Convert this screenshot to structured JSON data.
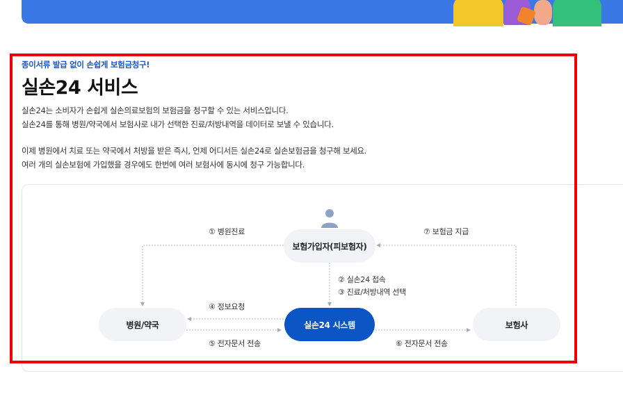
{
  "section": {
    "eyebrow": "종이서류 발급 없이 손쉽게 보험금청구!",
    "title": "실손24 서비스",
    "description": [
      "실손24는 소비자가 손쉽게 실손의료보험의 보험금을 청구할 수 있는 서비스입니다.",
      "실손24를 통해 병원/약국에서 보험사로 내가 선택한 진료/처방내역을 데이터로 보낼 수 있습니다.",
      "이제 병원에서 치료 또는 약국에서 처방을 받은 즉시, 언제 어디서든 실손24로 실손보험금을 청구해 보세요.",
      "여러 개의 실손보험에 가입했을 경우에도 한번에 여러 보험사에 동시에 청구 가능합니다."
    ]
  },
  "diagram": {
    "nodes": {
      "insured": "보험가입자(피보험자)",
      "hospital": "병원/약국",
      "system": "실손24 시스템",
      "insurer": "보험사"
    },
    "steps": {
      "s1": "① 병원진료",
      "s2": "② 실손24 접속",
      "s3": "③ 진료/처방내역 선택",
      "s4": "④ 정보요청",
      "s5": "⑤ 전자문서 전송",
      "s6": "⑥ 전자문서 전송",
      "s7": "⑦ 보험금 지급"
    }
  },
  "icons": {
    "person": "person-icon"
  },
  "colors": {
    "accent": "#0b55c4",
    "banner": "#3a78e6",
    "eyebrow": "#1c56c8",
    "highlight": "#ee0000"
  }
}
